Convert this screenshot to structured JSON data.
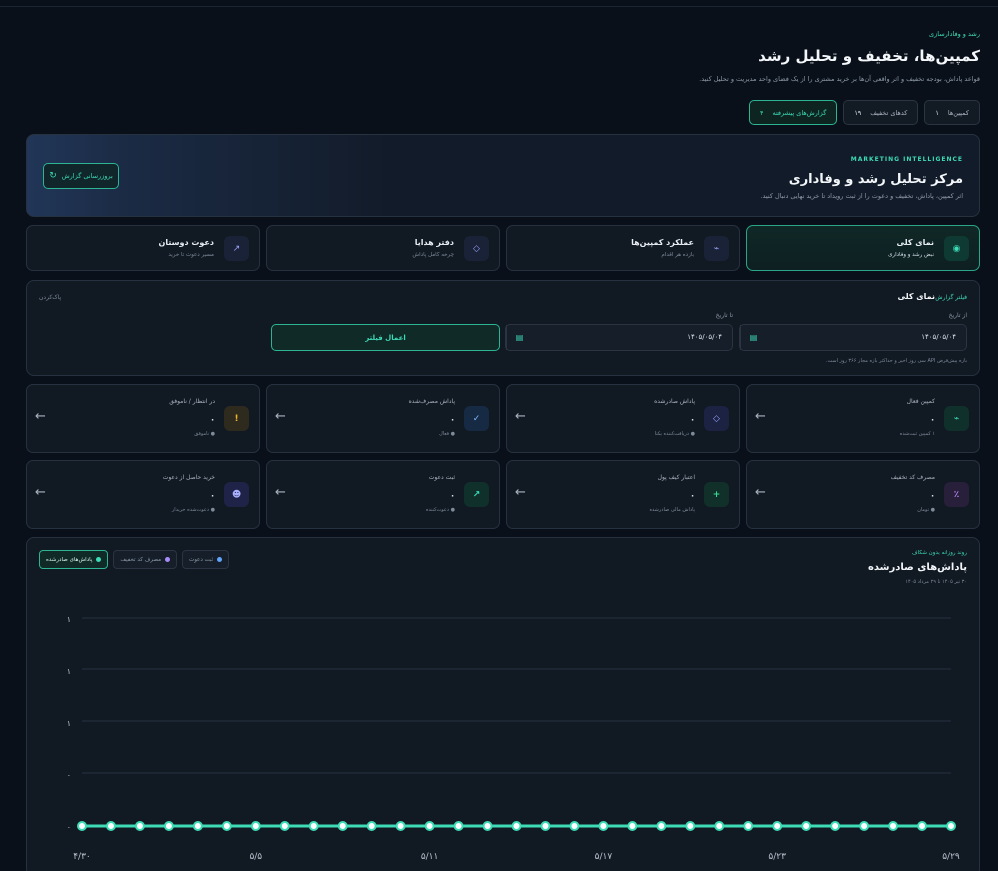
{
  "header": {
    "eyebrow": "رشد و وفادارسازی",
    "title": "کمپین‌ها، تخفیف و تحلیل رشد",
    "description": "قواعد پاداش، بودجه تخفیف و اثر واقعی آن‌ها بر خرید مشتری را از یک فضای واحد مدیریت و تحلیل کنید."
  },
  "tabs": [
    {
      "label": "کمپین‌ها",
      "count": "۱"
    },
    {
      "label": "کدهای تخفیف",
      "count": "۱۹"
    },
    {
      "label": "گزارش‌های پیشرفته",
      "count": "۴"
    }
  ],
  "hero": {
    "eyebrow": "MARKETING INTELLIGENCE",
    "title": "مرکز تحلیل رشد و وفاداری",
    "description": "اثر کمپین، پاداش، تخفیف و دعوت را از ثبت رویداد تا خرید نهایی دنبال کنید.",
    "refresh_label": "بروزرسانی گزارش",
    "refresh_icon": "refresh-icon"
  },
  "nav_cards": [
    {
      "title": "نمای کلی",
      "sub": "نبض رشد و وفاداری",
      "icon": "◉"
    },
    {
      "title": "عملکرد کمپین‌ها",
      "sub": "بازده هر اقدام",
      "icon": "⌁"
    },
    {
      "title": "دفتر هدایا",
      "sub": "چرخه کامل پاداش",
      "icon": "◇"
    },
    {
      "title": "دعوت دوستان",
      "sub": "مسیر دعوت تا خرید",
      "icon": "↗"
    }
  ],
  "filter": {
    "eyebrow": "فیلتر گزارش",
    "title": "نمای کلی",
    "clear_label": "پاک‌کردن",
    "from_label": "از تاریخ",
    "to_label": "تا تاریخ",
    "from_value": "۱۴۰۵/۰۵/۰۴",
    "to_value": "۱۴۰۵/۰۵/۰۴",
    "apply_label": "اعمال فیلتر",
    "note": "بازه پیش‌فرض API سی روز اخیر و حداکثر بازه مجاز ۳۶۶ روز است."
  },
  "kpis": [
    {
      "title": "کمپین فعال",
      "value": "۰",
      "sub": "۱ کمپین ثبت‌شده",
      "icon": "⌁",
      "icon_color": "#3ddbb6",
      "icon_bg": "#10302c"
    },
    {
      "title": "پاداش صادرشده",
      "value": "۰",
      "sub": "● دریافت‌کننده یکتا",
      "icon": "◇",
      "icon_color": "#9aa4ff",
      "icon_bg": "#1c2242"
    },
    {
      "title": "پاداش مصرف‌شده",
      "value": "۰",
      "sub": "● فعال",
      "icon": "✓",
      "icon_color": "#7fb8ff",
      "icon_bg": "#172a44"
    },
    {
      "title": "در انتظار / ناموفق",
      "value": "۰",
      "sub": "● ناموفق",
      "icon": "!",
      "icon_color": "#f0b429",
      "icon_bg": "#2e2a1e"
    },
    {
      "title": "مصرف کد تخفیف",
      "value": "۰",
      "sub": "● تومان",
      "icon": "٪",
      "icon_color": "#c58cff",
      "icon_bg": "#281f3a"
    },
    {
      "title": "اعتبار کیف پول",
      "value": "۰",
      "sub": "پاداش مالی صادرشده",
      "icon": "+",
      "icon_color": "#3ddb8f",
      "icon_bg": "#12302a"
    },
    {
      "title": "ثبت دعوت",
      "value": "۰",
      "sub": "● دعوت‌کننده",
      "icon": "↗",
      "icon_color": "#3ddbb6",
      "icon_bg": "#10302c"
    },
    {
      "title": "خرید حاصل از دعوت",
      "value": "۰",
      "sub": "● دعوت‌شده خریدار",
      "icon": "☻",
      "icon_color": "#a9b0ff",
      "icon_bg": "#1f2348"
    }
  ],
  "chart": {
    "eyebrow": "روند روزانه بدون شکاف",
    "title": "پاداش‌های صادرشده",
    "subtitle": "۳۰ تیر ۱۴۰۵ تا ۲۹ مرداد ۱۴۰۵",
    "legend": [
      {
        "label": "پاداش‌های صادرشده",
        "color": "#3ddbb6"
      },
      {
        "label": "مصرف کد تخفیف",
        "color": "#a78bfa"
      },
      {
        "label": "ثبت دعوت",
        "color": "#60a5fa"
      }
    ],
    "line_color": "#3ddbb6"
  },
  "chart_data": {
    "type": "line",
    "title": "پاداش‌های صادرشده",
    "y_ticks": [
      "۱",
      "۱",
      "۱",
      "۰",
      "۰"
    ],
    "x_ticks": [
      "۴/۳۰",
      "۵/۵",
      "۵/۱۱",
      "۵/۱۷",
      "۵/۲۳",
      "۵/۲۹"
    ],
    "series": [
      {
        "name": "پاداش‌های صادرشده",
        "values": [
          0,
          0,
          0,
          0,
          0,
          0,
          0,
          0,
          0,
          0,
          0,
          0,
          0,
          0,
          0,
          0,
          0,
          0,
          0,
          0,
          0,
          0,
          0,
          0,
          0,
          0,
          0,
          0,
          0,
          0,
          0
        ]
      }
    ],
    "ylim": [
      0,
      1
    ],
    "grid": true
  }
}
